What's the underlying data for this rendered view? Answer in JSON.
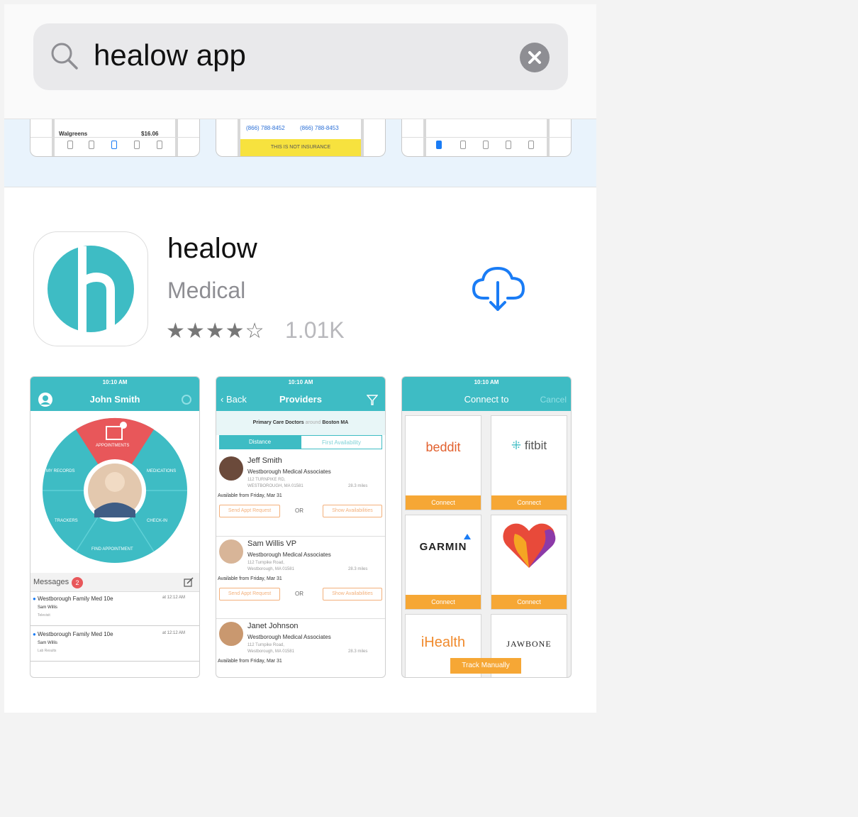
{
  "search": {
    "query": "healow app"
  },
  "previous_result": {
    "shot1": {
      "pharmacy": "Walgreens",
      "price": "$16.06"
    },
    "shot2": {
      "phone1": "(866) 788-8452",
      "phone2": "(866) 788-8453",
      "banner": "THIS IS NOT INSURANCE"
    }
  },
  "app": {
    "name": "healow",
    "category": "Medical",
    "rating_stars": "★★★★☆",
    "rating_count": "1.01K"
  },
  "screenshot1": {
    "status_time": "10:10 AM",
    "title": "John Smith",
    "wheel_labels": [
      "APPOINTMENTS",
      "MEDICATIONS",
      "CHECK-IN",
      "FIND APPOINTMENT",
      "TRACKERS",
      "MY RECORDS"
    ],
    "messages_label": "Messages",
    "messages_count": "2",
    "messages": [
      {
        "from": "Westborough Family Med 10e",
        "time": "at 12:12 AM",
        "sender": "Sam Willis",
        "subject": "Televisit"
      },
      {
        "from": "Westborough Family Med 10e",
        "time": "at 12:12 AM",
        "sender": "Sam Willis",
        "subject": "Lab Results"
      }
    ]
  },
  "screenshot2": {
    "status_time": "10:10 AM",
    "back_label": "Back",
    "title": "Providers",
    "filter_primary": "Primary Care Doctors",
    "filter_around": "around",
    "filter_location": "Boston MA",
    "seg_left": "Distance",
    "seg_right": "First Availability",
    "providers": [
      {
        "name": "Jeff Smith",
        "practice": "Westborough Medical Associates",
        "addr1": "112 TURNPIKE RD,",
        "addr2": "WESTBOROUGH, MA 01581",
        "distance": "28.3 miles",
        "available": "Available from Friday, Mar 31"
      },
      {
        "name": "Sam Willis VP",
        "practice": "Westborough Medical Associates",
        "addr1": "112 Turnpike Road,",
        "addr2": "Westborough, MA 01581",
        "distance": "28.3 miles",
        "available": "Available from Friday, Mar 31"
      },
      {
        "name": "Janet Johnson",
        "practice": "Westborough Medical Associates",
        "addr1": "112 Turnpike Road,",
        "addr2": "Westborough, MA 01581",
        "distance": "28.3 miles",
        "available": "Available from Friday, Mar 31"
      }
    ],
    "send_request": "Send Appt Request",
    "or_label": "OR",
    "show_availabilities": "Show Availabilities"
  },
  "screenshot3": {
    "status_time": "10:10 AM",
    "title": "Connect to",
    "cancel_label": "Cancel",
    "tiles": [
      "beddit",
      "fitbit",
      "GARMIN",
      "",
      "iHealth",
      "JAWBONE"
    ],
    "connect_label": "Connect",
    "track_manually": "Track Manually"
  },
  "colors": {
    "teal": "#3ebcc4",
    "ios_blue": "#1a7cf5",
    "orange": "#f6a735",
    "appointment_red": "#e8575a"
  }
}
